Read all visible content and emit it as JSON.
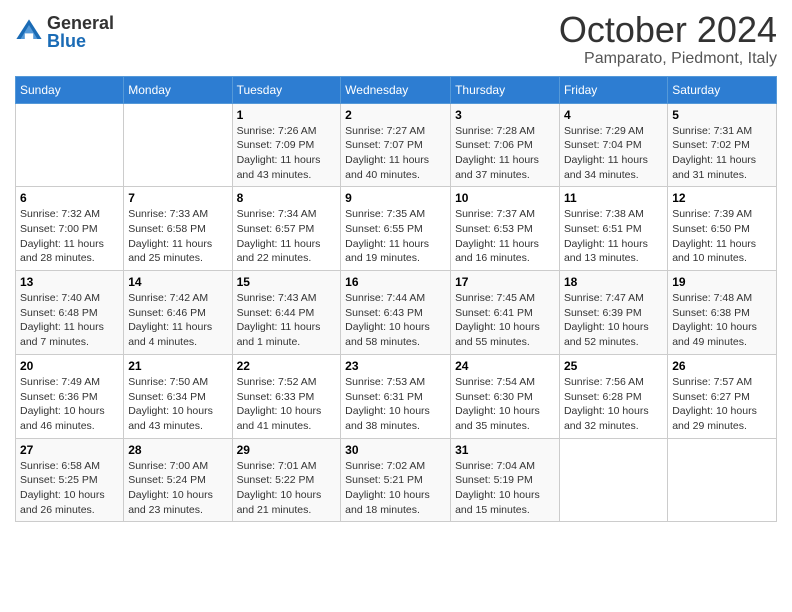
{
  "header": {
    "logo_general": "General",
    "logo_blue": "Blue",
    "month_title": "October 2024",
    "location": "Pamparato, Piedmont, Italy"
  },
  "weekdays": [
    "Sunday",
    "Monday",
    "Tuesday",
    "Wednesday",
    "Thursday",
    "Friday",
    "Saturday"
  ],
  "weeks": [
    [
      {
        "day": "",
        "sunrise": "",
        "sunset": "",
        "daylight": ""
      },
      {
        "day": "",
        "sunrise": "",
        "sunset": "",
        "daylight": ""
      },
      {
        "day": "1",
        "sunrise": "Sunrise: 7:26 AM",
        "sunset": "Sunset: 7:09 PM",
        "daylight": "Daylight: 11 hours and 43 minutes."
      },
      {
        "day": "2",
        "sunrise": "Sunrise: 7:27 AM",
        "sunset": "Sunset: 7:07 PM",
        "daylight": "Daylight: 11 hours and 40 minutes."
      },
      {
        "day": "3",
        "sunrise": "Sunrise: 7:28 AM",
        "sunset": "Sunset: 7:06 PM",
        "daylight": "Daylight: 11 hours and 37 minutes."
      },
      {
        "day": "4",
        "sunrise": "Sunrise: 7:29 AM",
        "sunset": "Sunset: 7:04 PM",
        "daylight": "Daylight: 11 hours and 34 minutes."
      },
      {
        "day": "5",
        "sunrise": "Sunrise: 7:31 AM",
        "sunset": "Sunset: 7:02 PM",
        "daylight": "Daylight: 11 hours and 31 minutes."
      }
    ],
    [
      {
        "day": "6",
        "sunrise": "Sunrise: 7:32 AM",
        "sunset": "Sunset: 7:00 PM",
        "daylight": "Daylight: 11 hours and 28 minutes."
      },
      {
        "day": "7",
        "sunrise": "Sunrise: 7:33 AM",
        "sunset": "Sunset: 6:58 PM",
        "daylight": "Daylight: 11 hours and 25 minutes."
      },
      {
        "day": "8",
        "sunrise": "Sunrise: 7:34 AM",
        "sunset": "Sunset: 6:57 PM",
        "daylight": "Daylight: 11 hours and 22 minutes."
      },
      {
        "day": "9",
        "sunrise": "Sunrise: 7:35 AM",
        "sunset": "Sunset: 6:55 PM",
        "daylight": "Daylight: 11 hours and 19 minutes."
      },
      {
        "day": "10",
        "sunrise": "Sunrise: 7:37 AM",
        "sunset": "Sunset: 6:53 PM",
        "daylight": "Daylight: 11 hours and 16 minutes."
      },
      {
        "day": "11",
        "sunrise": "Sunrise: 7:38 AM",
        "sunset": "Sunset: 6:51 PM",
        "daylight": "Daylight: 11 hours and 13 minutes."
      },
      {
        "day": "12",
        "sunrise": "Sunrise: 7:39 AM",
        "sunset": "Sunset: 6:50 PM",
        "daylight": "Daylight: 11 hours and 10 minutes."
      }
    ],
    [
      {
        "day": "13",
        "sunrise": "Sunrise: 7:40 AM",
        "sunset": "Sunset: 6:48 PM",
        "daylight": "Daylight: 11 hours and 7 minutes."
      },
      {
        "day": "14",
        "sunrise": "Sunrise: 7:42 AM",
        "sunset": "Sunset: 6:46 PM",
        "daylight": "Daylight: 11 hours and 4 minutes."
      },
      {
        "day": "15",
        "sunrise": "Sunrise: 7:43 AM",
        "sunset": "Sunset: 6:44 PM",
        "daylight": "Daylight: 11 hours and 1 minute."
      },
      {
        "day": "16",
        "sunrise": "Sunrise: 7:44 AM",
        "sunset": "Sunset: 6:43 PM",
        "daylight": "Daylight: 10 hours and 58 minutes."
      },
      {
        "day": "17",
        "sunrise": "Sunrise: 7:45 AM",
        "sunset": "Sunset: 6:41 PM",
        "daylight": "Daylight: 10 hours and 55 minutes."
      },
      {
        "day": "18",
        "sunrise": "Sunrise: 7:47 AM",
        "sunset": "Sunset: 6:39 PM",
        "daylight": "Daylight: 10 hours and 52 minutes."
      },
      {
        "day": "19",
        "sunrise": "Sunrise: 7:48 AM",
        "sunset": "Sunset: 6:38 PM",
        "daylight": "Daylight: 10 hours and 49 minutes."
      }
    ],
    [
      {
        "day": "20",
        "sunrise": "Sunrise: 7:49 AM",
        "sunset": "Sunset: 6:36 PM",
        "daylight": "Daylight: 10 hours and 46 minutes."
      },
      {
        "day": "21",
        "sunrise": "Sunrise: 7:50 AM",
        "sunset": "Sunset: 6:34 PM",
        "daylight": "Daylight: 10 hours and 43 minutes."
      },
      {
        "day": "22",
        "sunrise": "Sunrise: 7:52 AM",
        "sunset": "Sunset: 6:33 PM",
        "daylight": "Daylight: 10 hours and 41 minutes."
      },
      {
        "day": "23",
        "sunrise": "Sunrise: 7:53 AM",
        "sunset": "Sunset: 6:31 PM",
        "daylight": "Daylight: 10 hours and 38 minutes."
      },
      {
        "day": "24",
        "sunrise": "Sunrise: 7:54 AM",
        "sunset": "Sunset: 6:30 PM",
        "daylight": "Daylight: 10 hours and 35 minutes."
      },
      {
        "day": "25",
        "sunrise": "Sunrise: 7:56 AM",
        "sunset": "Sunset: 6:28 PM",
        "daylight": "Daylight: 10 hours and 32 minutes."
      },
      {
        "day": "26",
        "sunrise": "Sunrise: 7:57 AM",
        "sunset": "Sunset: 6:27 PM",
        "daylight": "Daylight: 10 hours and 29 minutes."
      }
    ],
    [
      {
        "day": "27",
        "sunrise": "Sunrise: 6:58 AM",
        "sunset": "Sunset: 5:25 PM",
        "daylight": "Daylight: 10 hours and 26 minutes."
      },
      {
        "day": "28",
        "sunrise": "Sunrise: 7:00 AM",
        "sunset": "Sunset: 5:24 PM",
        "daylight": "Daylight: 10 hours and 23 minutes."
      },
      {
        "day": "29",
        "sunrise": "Sunrise: 7:01 AM",
        "sunset": "Sunset: 5:22 PM",
        "daylight": "Daylight: 10 hours and 21 minutes."
      },
      {
        "day": "30",
        "sunrise": "Sunrise: 7:02 AM",
        "sunset": "Sunset: 5:21 PM",
        "daylight": "Daylight: 10 hours and 18 minutes."
      },
      {
        "day": "31",
        "sunrise": "Sunrise: 7:04 AM",
        "sunset": "Sunset: 5:19 PM",
        "daylight": "Daylight: 10 hours and 15 minutes."
      },
      {
        "day": "",
        "sunrise": "",
        "sunset": "",
        "daylight": ""
      },
      {
        "day": "",
        "sunrise": "",
        "sunset": "",
        "daylight": ""
      }
    ]
  ]
}
